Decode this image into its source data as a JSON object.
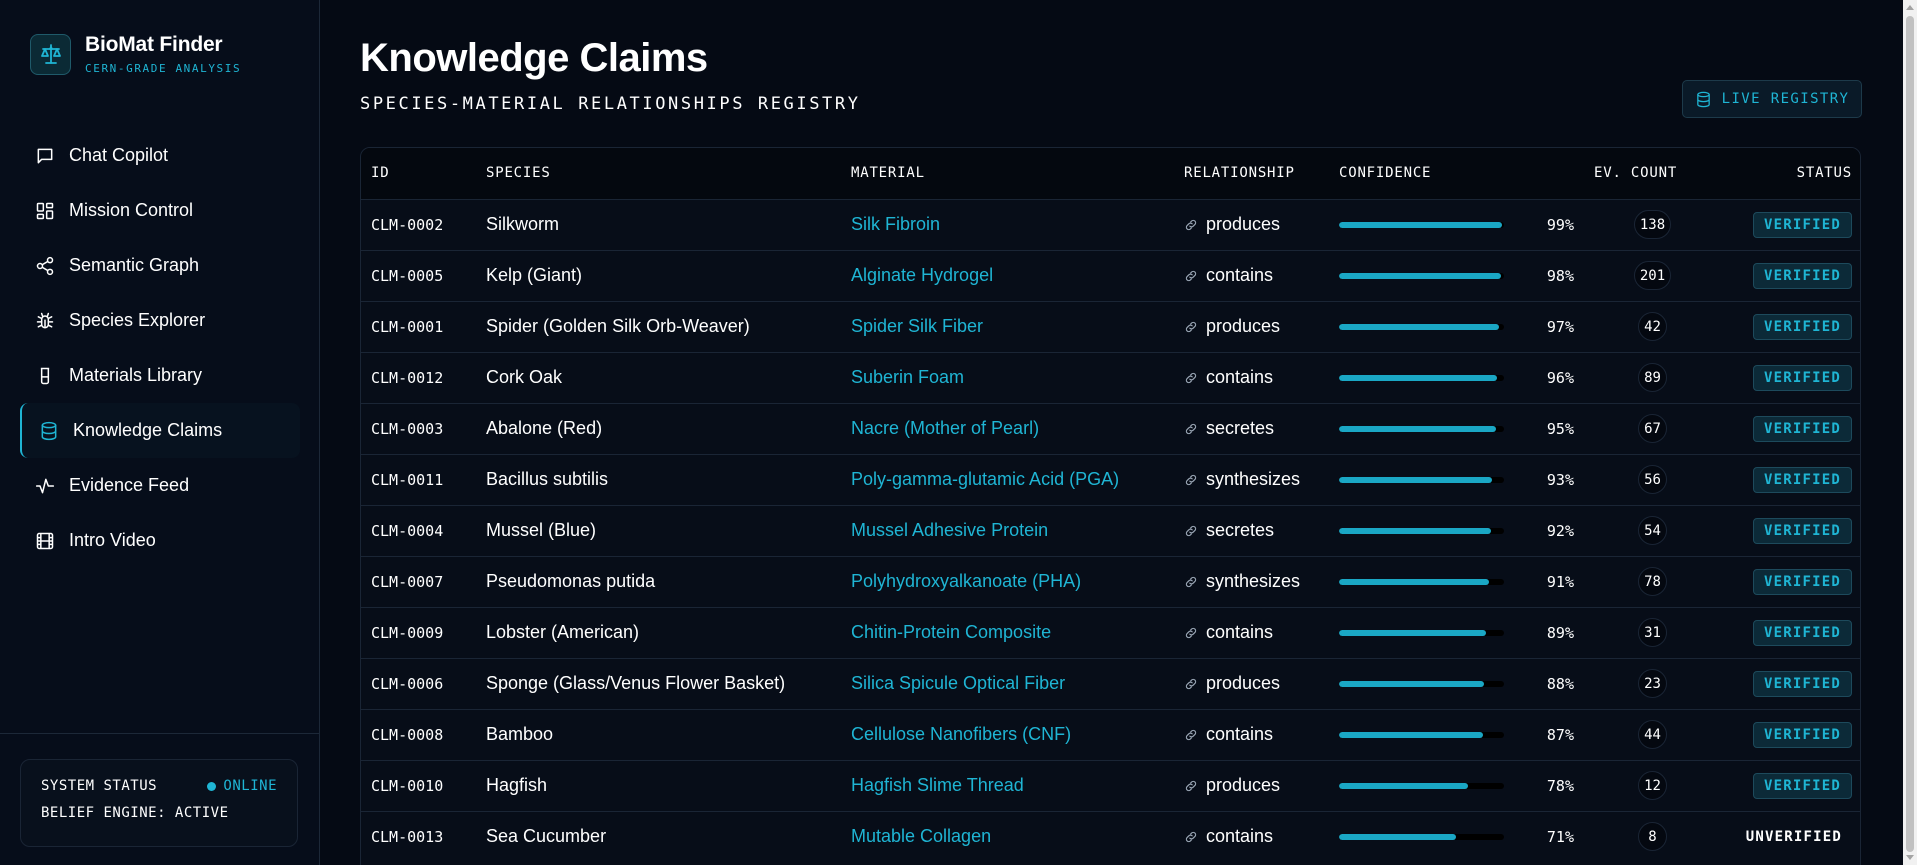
{
  "brand": {
    "title": "BioMat Finder",
    "subtitle": "CERN-GRADE ANALYSIS"
  },
  "nav": [
    {
      "label": "Chat Copilot",
      "icon": "chat-icon",
      "active": false
    },
    {
      "label": "Mission Control",
      "icon": "dashboard-icon",
      "active": false
    },
    {
      "label": "Semantic Graph",
      "icon": "share-icon",
      "active": false
    },
    {
      "label": "Species Explorer",
      "icon": "bug-icon",
      "active": false
    },
    {
      "label": "Materials Library",
      "icon": "flask-icon",
      "active": false
    },
    {
      "label": "Knowledge Claims",
      "icon": "database-icon",
      "active": true
    },
    {
      "label": "Evidence Feed",
      "icon": "activity-icon",
      "active": false
    },
    {
      "label": "Intro Video",
      "icon": "film-icon",
      "active": false
    }
  ],
  "system": {
    "label": "SYSTEM STATUS",
    "status": "ONLINE",
    "engine": "BELIEF ENGINE: ACTIVE"
  },
  "page": {
    "title": "Knowledge Claims",
    "subtitle": "SPECIES-MATERIAL RELATIONSHIPS REGISTRY",
    "live_button": "LIVE REGISTRY"
  },
  "table": {
    "headers": [
      "ID",
      "SPECIES",
      "MATERIAL",
      "RELATIONSHIP",
      "CONFIDENCE",
      "EV. COUNT",
      "STATUS"
    ],
    "rows": [
      {
        "id": "CLM-0002",
        "species": "Silkworm",
        "material": "Silk Fibroin",
        "relationship": "produces",
        "confidence": "99%",
        "ev": "138",
        "status": "VERIFIED"
      },
      {
        "id": "CLM-0005",
        "species": "Kelp (Giant)",
        "material": "Alginate Hydrogel",
        "relationship": "contains",
        "confidence": "98%",
        "ev": "201",
        "status": "VERIFIED"
      },
      {
        "id": "CLM-0001",
        "species": "Spider (Golden Silk Orb-Weaver)",
        "material": "Spider Silk Fiber",
        "relationship": "produces",
        "confidence": "97%",
        "ev": "42",
        "status": "VERIFIED"
      },
      {
        "id": "CLM-0012",
        "species": "Cork Oak",
        "material": "Suberin Foam",
        "relationship": "contains",
        "confidence": "96%",
        "ev": "89",
        "status": "VERIFIED"
      },
      {
        "id": "CLM-0003",
        "species": "Abalone (Red)",
        "material": "Nacre (Mother of Pearl)",
        "relationship": "secretes",
        "confidence": "95%",
        "ev": "67",
        "status": "VERIFIED"
      },
      {
        "id": "CLM-0011",
        "species": "Bacillus subtilis",
        "material": "Poly-gamma-glutamic Acid (PGA)",
        "relationship": "synthesizes",
        "confidence": "93%",
        "ev": "56",
        "status": "VERIFIED"
      },
      {
        "id": "CLM-0004",
        "species": "Mussel (Blue)",
        "material": "Mussel Adhesive Protein",
        "relationship": "secretes",
        "confidence": "92%",
        "ev": "54",
        "status": "VERIFIED"
      },
      {
        "id": "CLM-0007",
        "species": "Pseudomonas putida",
        "material": "Polyhydroxyalkanoate (PHA)",
        "relationship": "synthesizes",
        "confidence": "91%",
        "ev": "78",
        "status": "VERIFIED"
      },
      {
        "id": "CLM-0009",
        "species": "Lobster (American)",
        "material": "Chitin-Protein Composite",
        "relationship": "contains",
        "confidence": "89%",
        "ev": "31",
        "status": "VERIFIED"
      },
      {
        "id": "CLM-0006",
        "species": "Sponge (Glass/Venus Flower Basket)",
        "material": "Silica Spicule Optical Fiber",
        "relationship": "produces",
        "confidence": "88%",
        "ev": "23",
        "status": "VERIFIED"
      },
      {
        "id": "CLM-0008",
        "species": "Bamboo",
        "material": "Cellulose Nanofibers (CNF)",
        "relationship": "contains",
        "confidence": "87%",
        "ev": "44",
        "status": "VERIFIED"
      },
      {
        "id": "CLM-0010",
        "species": "Hagfish",
        "material": "Hagfish Slime Thread",
        "relationship": "produces",
        "confidence": "78%",
        "ev": "12",
        "status": "VERIFIED"
      },
      {
        "id": "CLM-0013",
        "species": "Sea Cucumber",
        "material": "Mutable Collagen",
        "relationship": "contains",
        "confidence": "71%",
        "ev": "8",
        "status": "UNVERIFIED"
      }
    ]
  },
  "colors": {
    "accent": "#1fb5d4",
    "background": "#050a14",
    "sidebar": "#060d1a",
    "border": "#1a2535"
  }
}
